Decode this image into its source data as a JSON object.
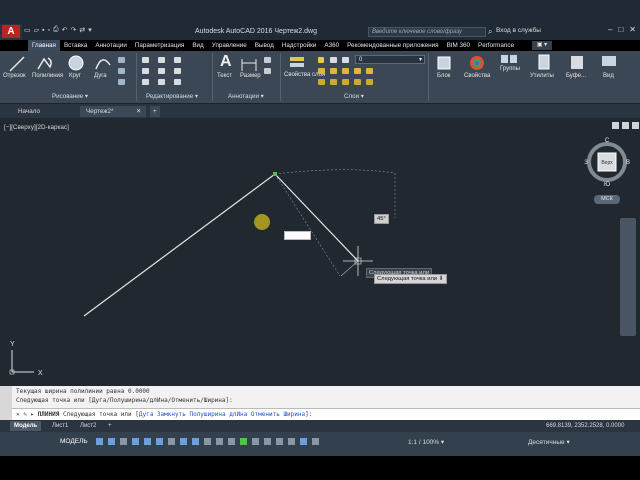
{
  "title_bar": {
    "title": "Autodesk AutoCAD 2016   Чертеж2.dwg",
    "search_placeholder": "Введите ключевое слово/фразу",
    "signin": "Вход в службы",
    "app_logo": "A"
  },
  "ribbon_tabs": [
    "Главная",
    "Вставка",
    "Аннотации",
    "Параметризация",
    "Вид",
    "Управление",
    "Вывод",
    "Надстройки",
    "A360",
    "Рекомендованные приложения",
    "BIM 360",
    "Performance"
  ],
  "active_tab": "Главная",
  "ribbon": {
    "draw_tools": [
      "Отрезок",
      "Полилиния",
      "Круг",
      "Дуга"
    ],
    "annotation_tools": [
      "Текст",
      "Размер"
    ],
    "layer_properties": "Свойства слоя",
    "layer_value": "0",
    "block": "Блок",
    "properties": "Свойства",
    "groups": "Группы",
    "utilities": "Утилиты",
    "clipboard": "Буфе...",
    "view": "Вид",
    "panels": [
      "Рисование ▾",
      "Редактирование ▾",
      "Аннотации ▾",
      "Слои ▾"
    ]
  },
  "file_tabs": [
    "Начало",
    "Чертеж2*"
  ],
  "viewport_label": "[−][Сверху][2D-каркас]",
  "viewcube": {
    "north": "С",
    "south": "Ю",
    "west": "З",
    "east": "В",
    "face": "Верх"
  },
  "wcs_label": "МСК",
  "tooltips": {
    "angle": "45°",
    "prompt1": "Следующая точка или",
    "prompt2": "Следующая точка или"
  },
  "command_history": [
    "Текущая ширина полилинии равна 0.0000",
    "Следующая точка или [Дуга/Полуширина/длИна/Отменить/Ширина]:"
  ],
  "command_line": {
    "prefix": "ПЛИНИЯ",
    "prompt": "Следующая точка или [",
    "options": [
      "Дуга",
      "Замкнуть",
      "Полуширина",
      "длИна",
      "Отменить",
      "Ширина"
    ],
    "suffix": "]:"
  },
  "layout_tabs": [
    "Модель",
    "Лист1",
    "Лист2"
  ],
  "coordinates": "669.8139, 2352.2528, 0.0000",
  "status": {
    "model": "МОДЕЛЬ",
    "scale": "1:1 / 100% ▾",
    "units": "Десятичные ▾"
  },
  "ucs": {
    "x": "X",
    "y": "Y"
  },
  "colors": {
    "canvas": "#212830",
    "polyline": "#e6e6e6",
    "ribbon": "#3b4755",
    "accent": "#1a56c8"
  }
}
